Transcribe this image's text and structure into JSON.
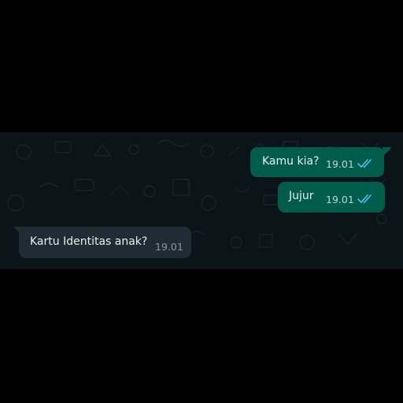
{
  "conversation": {
    "messages": [
      {
        "direction": "outgoing",
        "text": "Kamu kia?",
        "time": "19.01",
        "status": "read",
        "status_icon": "double-check-icon",
        "status_color": "#53bdeb"
      },
      {
        "direction": "outgoing",
        "text": "Jujur",
        "time": "19.01",
        "status": "read",
        "status_icon": "double-check-icon",
        "status_color": "#53bdeb"
      },
      {
        "direction": "incoming",
        "text": "Kartu Identitas anak?",
        "time": "19.01"
      }
    ]
  },
  "colors": {
    "background": "#000000",
    "chat_background": "#0b1418",
    "outgoing_bubble": "#005c4b",
    "incoming_bubble": "#1f2c34",
    "read_ticks": "#53bdeb"
  }
}
